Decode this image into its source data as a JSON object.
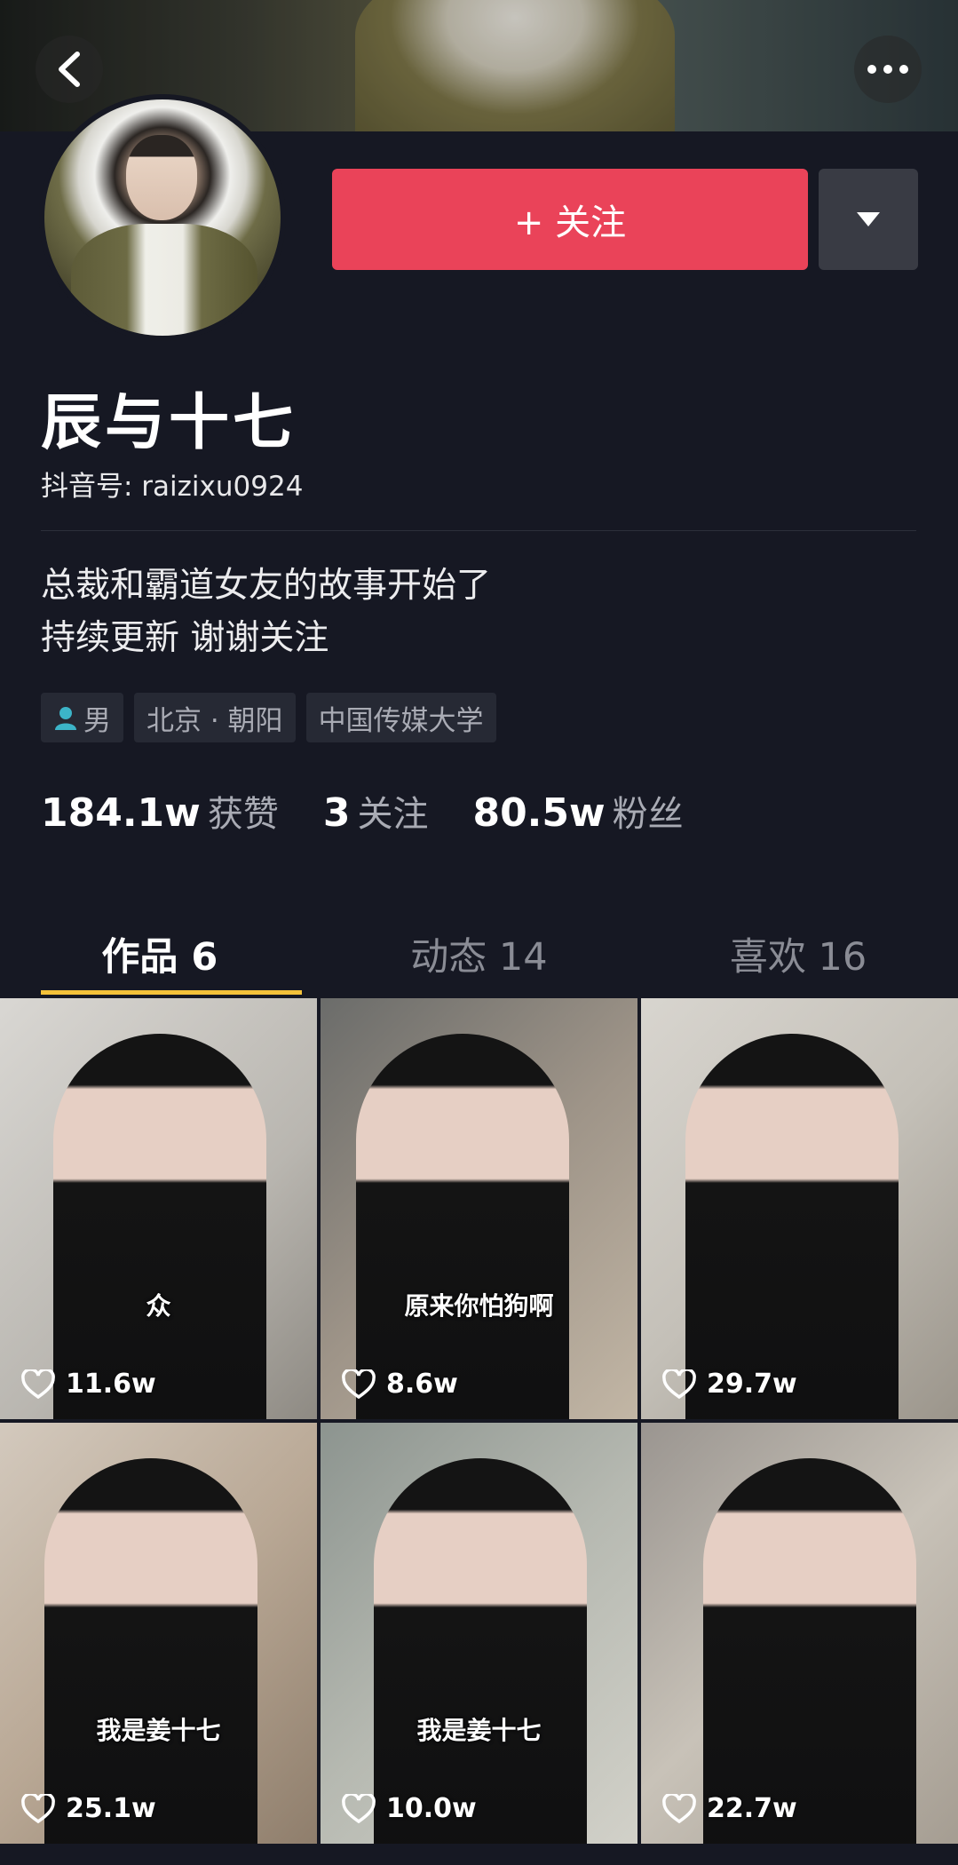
{
  "profile": {
    "name": "辰与十七",
    "douyin_id": "抖音号: raizixu0924",
    "follow_label": "+ 关注",
    "bio_lines": [
      "总裁和霸道女友的故事开始了",
      "持续更新 谢谢关注"
    ],
    "tags": [
      "男",
      "北京 · 朝阳",
      "中国传媒大学"
    ],
    "stats": [
      {
        "num": "184.1w",
        "label": "获赞"
      },
      {
        "num": "3",
        "label": "关注"
      },
      {
        "num": "80.5w",
        "label": "粉丝"
      }
    ]
  },
  "tabs": [
    {
      "label": "作品 6",
      "active": true
    },
    {
      "label": "动态 14",
      "active": false
    },
    {
      "label": "喜欢 16",
      "active": false
    }
  ],
  "videos": [
    {
      "caption": "众",
      "likes": "11.6w"
    },
    {
      "caption": "原来你怕狗啊",
      "likes": "8.6w"
    },
    {
      "caption": "",
      "likes": "29.7w"
    },
    {
      "caption": "我是姜十七",
      "likes": "25.1w"
    },
    {
      "caption": "我是姜十七",
      "likes": "10.0w"
    },
    {
      "caption": "",
      "likes": "22.7w"
    }
  ],
  "colors": {
    "accent": "#ea4359",
    "tab_indicator": "#f4c23a",
    "background": "#161823"
  },
  "icons": [
    "back-arrow-icon",
    "more-dots-icon",
    "triangle-down-icon",
    "gender-male-icon",
    "heart-icon"
  ]
}
